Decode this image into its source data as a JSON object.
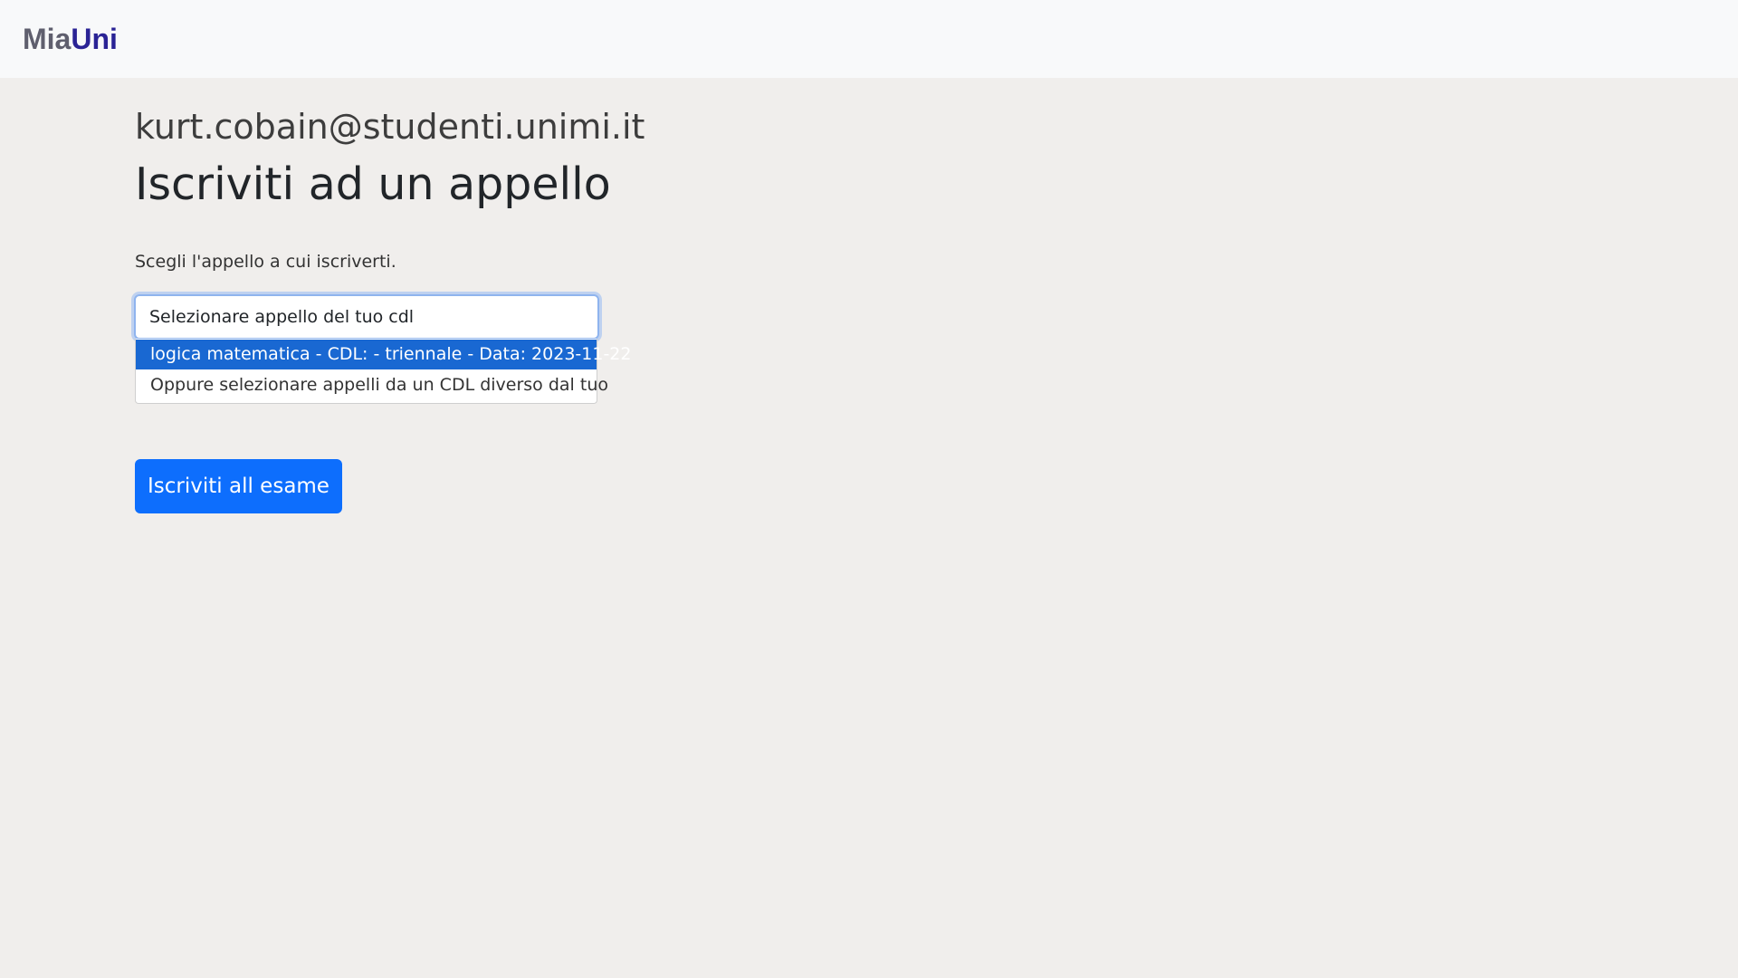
{
  "navbar": {
    "brand_part1": "Mia",
    "brand_part2": "Uni"
  },
  "main": {
    "user_email": "kurt.cobain@studenti.unimi.it",
    "title": "Iscriviti ad un appello",
    "instruction": "Scegli l'appello a cui iscriverti.",
    "select": {
      "selected_value": "Selezionare appello del tuo cdl",
      "options": [
        {
          "label": "logica matematica - CDL: - triennale - Data: 2023-11-22",
          "highlighted": true
        },
        {
          "label": "Oppure selezionare appelli da un CDL diverso dal tuo",
          "highlighted": false
        }
      ]
    },
    "submit_label": "Iscriviti all esame"
  },
  "colors": {
    "background": "#f0eeec",
    "navbar_background": "#f8f9fa",
    "brand_mia": "#5f5f6e",
    "brand_uni": "#2a2395",
    "primary_button": "#0d6efd",
    "highlighted_option": "#1968d2"
  }
}
